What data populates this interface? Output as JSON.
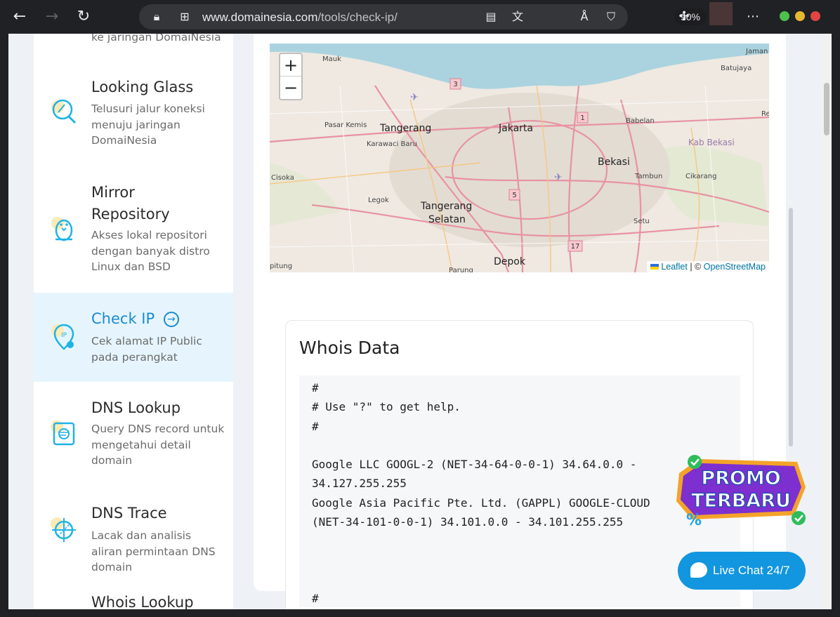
{
  "browser": {
    "url_host": "www.domainesia.com",
    "url_path": "/tools/check-ip/",
    "zoom": "90%"
  },
  "sidebar": {
    "top_partial_desc": "ke jaringan DomaiNesia",
    "items": [
      {
        "title": "Looking Glass",
        "desc": "Telusuri jalur koneksi menuju jaringan DomaiNesia",
        "icon": "looking-glass-icon"
      },
      {
        "title": "Mirror Repository",
        "desc": "Akses lokal repositori dengan banyak distro Linux dan BSD",
        "icon": "penguin-icon"
      },
      {
        "title": "Check IP",
        "desc": "Cek alamat IP Public pada perangkat",
        "icon": "ip-location-icon",
        "active": true
      },
      {
        "title": "DNS Lookup",
        "desc": "Query DNS record untuk mengetahui detail domain",
        "icon": "dns-search-icon"
      },
      {
        "title": "DNS Trace",
        "desc": "Lacak dan analisis aliran permintaan DNS domain",
        "icon": "crosshair-icon"
      },
      {
        "title": "Whois Lookup",
        "desc": "",
        "icon": ""
      }
    ]
  },
  "map": {
    "zoom_in": "+",
    "zoom_out": "−",
    "attribution_leaflet": "Leaflet",
    "attribution_sep": " | © ",
    "attribution_osm": "OpenStreetMap",
    "labels": [
      "Mauk",
      "Jaman",
      "Batujaya",
      "Pasar Kemis",
      "Tangerang",
      "Jakarta",
      "Babelan",
      "Karawaci Baru",
      "Kab Bekasi",
      "Bekasi",
      "Tambun",
      "Cikarang",
      "Cisoka",
      "Legok",
      "Tangerang",
      "Selatan",
      "Setu",
      "Depok",
      "Parung",
      "pitung",
      "Ren"
    ],
    "road_shields": [
      "3",
      "1",
      "5",
      "17"
    ]
  },
  "whois": {
    "heading": "Whois Data",
    "lines": [
      "#",
      "# Use \"?\" to get help.",
      "#",
      "",
      "Google LLC GOOGL-2 (NET-34-64-0-0-1) 34.64.0.0 -",
      "34.127.255.255",
      "Google Asia Pacific Pte. Ltd. (GAPPL) GOOGLE-CLOUD",
      "(NET-34-101-0-0-1) 34.101.0.0 - 34.101.255.255",
      "",
      "",
      "",
      "#"
    ]
  },
  "promo": {
    "line1": "PROMO",
    "line2": "TERBARU"
  },
  "chat": {
    "label": "Live Chat 24/7"
  },
  "colors": {
    "accent": "#1a8bd2",
    "chat": "#1296e0",
    "active_bg": "#e6f5fd"
  }
}
